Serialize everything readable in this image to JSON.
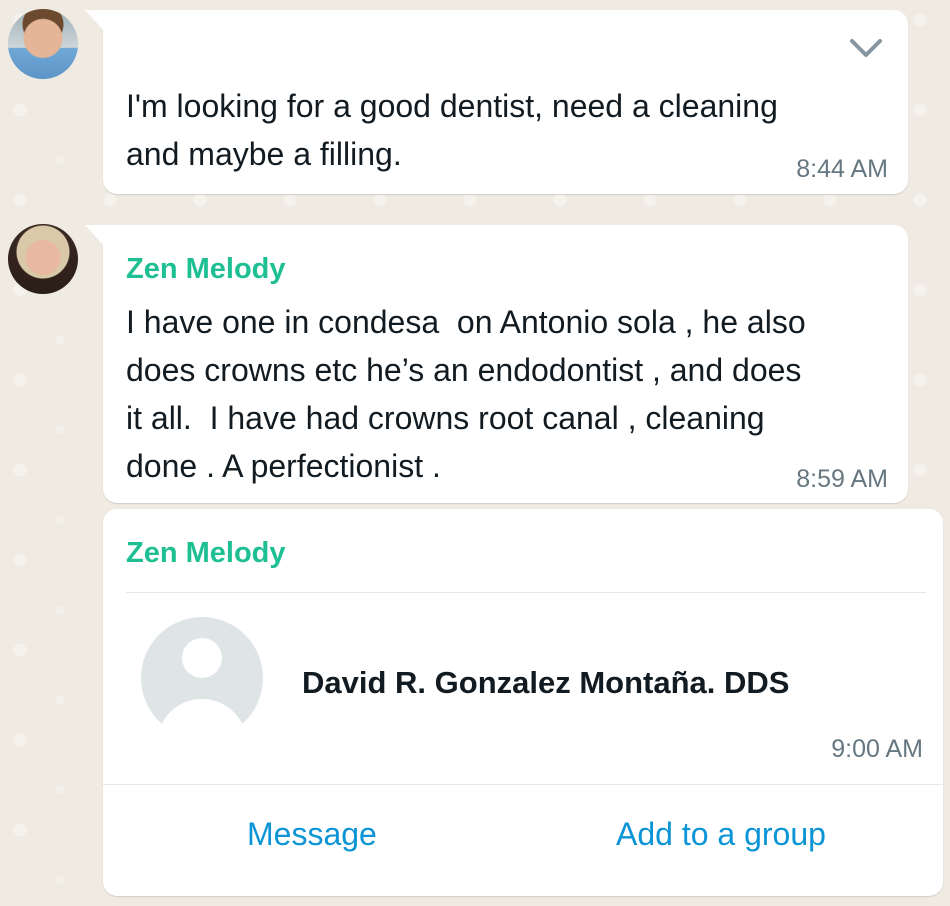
{
  "messages": [
    {
      "text": "I'm looking for a good dentist, need a cleaning\nand maybe a filling.",
      "time": "8:44 AM"
    },
    {
      "sender": "Zen Melody",
      "text": "I have one in condesa  on Antonio sola , he also\ndoes crowns etc he’s an endodontist , and does\nit all.  I have had crowns root canal , cleaning\ndone . A perfectionist .",
      "time": "8:59 AM"
    }
  ],
  "contact_card": {
    "sender": "Zen Melody",
    "contact_name": "David R. Gonzalez Montaña. DDS",
    "time": "9:00 AM",
    "actions": {
      "message": "Message",
      "add_to_group": "Add to a group"
    }
  },
  "icons": {
    "menu": "chevron-down-icon",
    "contact_avatar": "default-avatar-icon"
  },
  "colors": {
    "sender_name": "#1fbf94",
    "action_link": "#0b95d6",
    "bubble": "#ffffff",
    "background": "#efeae2"
  }
}
